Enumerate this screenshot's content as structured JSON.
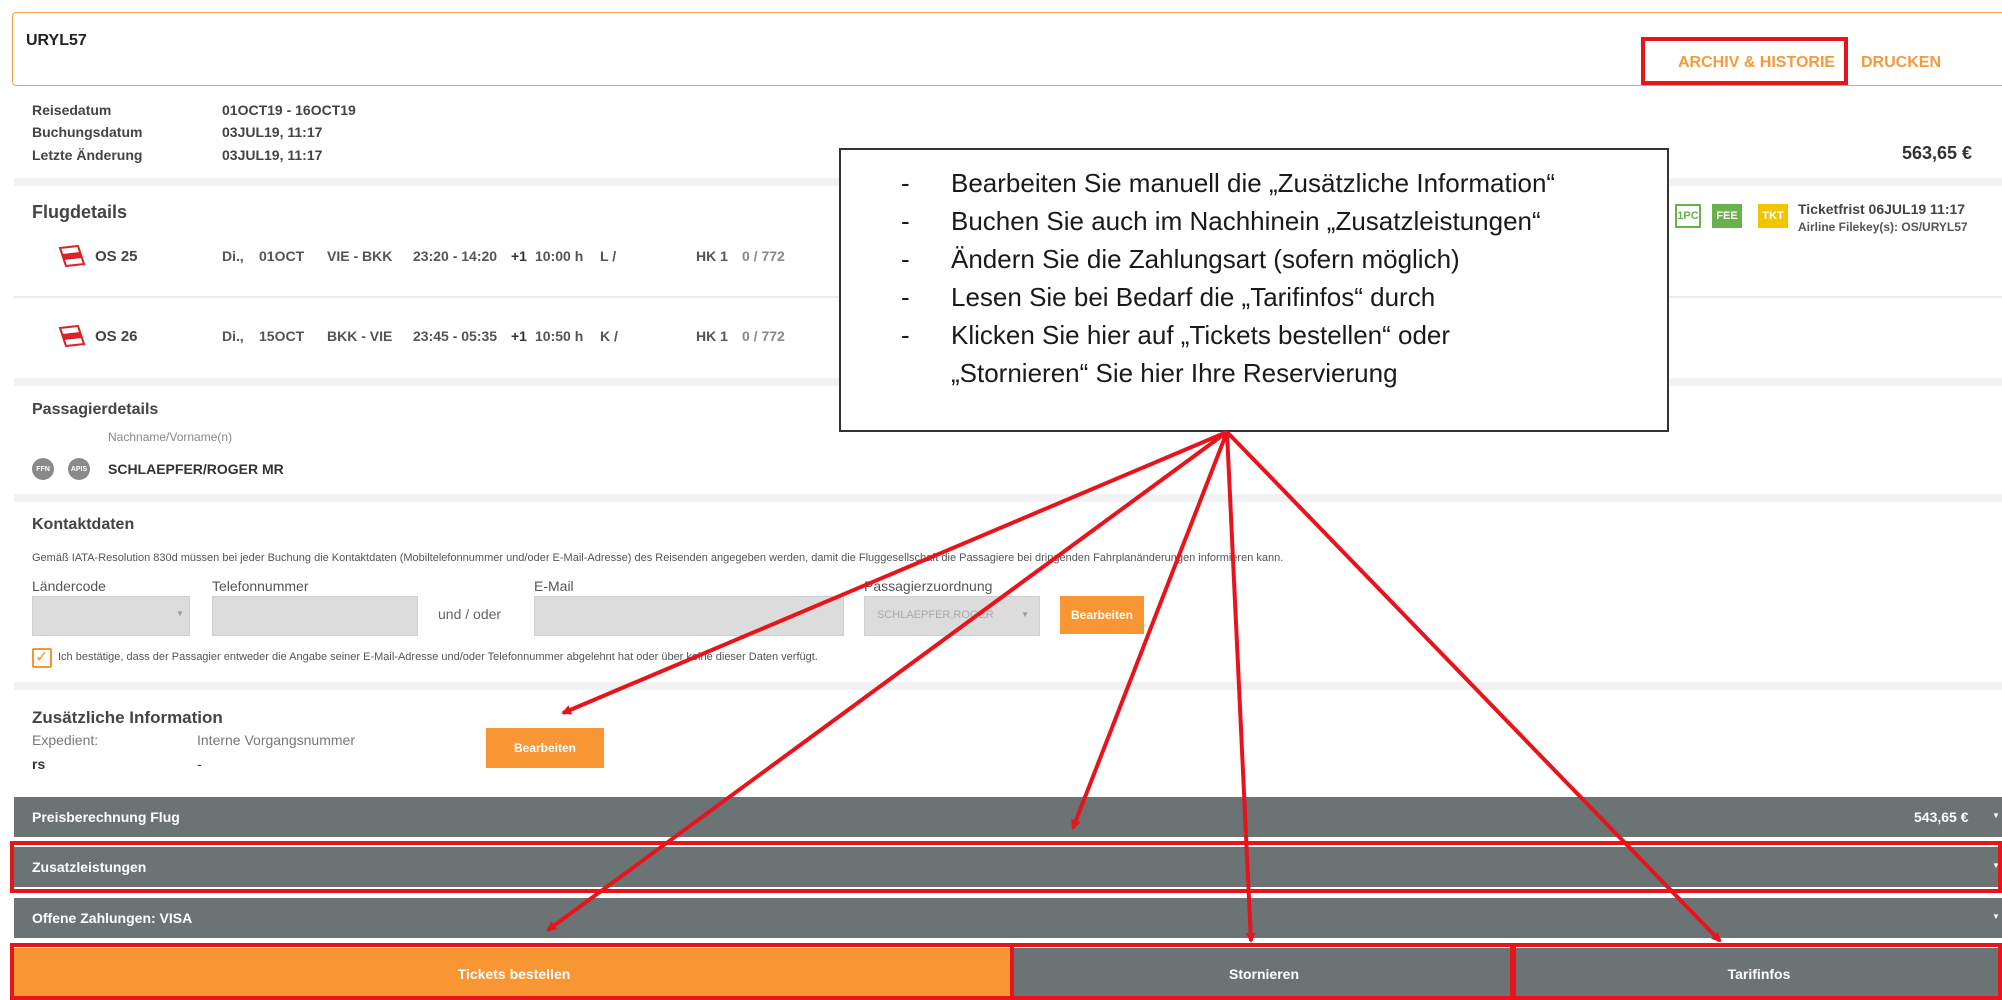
{
  "header": {
    "booking_code": "URYL57",
    "archive_link": "ARCHIV & HISTORIE",
    "print_link": "DRUCKEN"
  },
  "booking_info": {
    "travel_date_label": "Reisedatum",
    "travel_date_value": "01OCT19 - 16OCT19",
    "booking_date_label": "Buchungsdatum",
    "booking_date_value": "03JUL19, 11:17",
    "last_change_label": "Letzte Änderung",
    "last_change_value": "03JUL19, 11:17",
    "total_price": "563,65 €"
  },
  "flights": {
    "title": "Flugdetails",
    "badges": [
      "1PC",
      "FEE",
      "TKT"
    ],
    "ticket_deadline": "Ticketfrist 06JUL19 11:17",
    "airline_filekey": "Airline Filekey(s): OS/URYL57",
    "items": [
      {
        "code": "OS 25",
        "day": "Di.,",
        "date": "01OCT",
        "route": "VIE - BKK",
        "times": "23:20 - 14:20",
        "plus": "+1",
        "duration": "10:00 h",
        "class": "L /",
        "status": "HK 1",
        "extra": "0 / 772"
      },
      {
        "code": "OS 26",
        "day": "Di.,",
        "date": "15OCT",
        "route": "BKK - VIE",
        "times": "23:45 - 05:35",
        "plus": "+1",
        "duration": "10:50 h",
        "class": "K /",
        "status": "HK 1",
        "extra": "0 / 772"
      }
    ]
  },
  "passengers": {
    "title": "Passagierdetails",
    "name_header": "Nachname/Vorname(n)",
    "badge_ffn": "FFN",
    "badge_apis": "APIS",
    "name": "SCHLAEPFER/ROGER MR"
  },
  "contact": {
    "title": "Kontaktdaten",
    "notice": "Gemäß IATA-Resolution 830d müssen bei jeder Buchung die Kontaktdaten (Mobiltelefonnummer und/oder E-Mail-Adresse) des Reisenden angegeben werden, damit die Fluggesellschaft die Passagiere bei dringenden Fahrplanänderungen informieren kann.",
    "country_code_label": "Ländercode",
    "phone_label": "Telefonnummer",
    "or_label": "und / oder",
    "email_label": "E-Mail",
    "passenger_assign_label": "Passagierzuordnung",
    "passenger_assign_value": "SCHLAEPFER,ROGER",
    "edit_button": "Bearbeiten",
    "confirm_text": "Ich bestätige, dass der Passagier entweder die Angabe seiner E-Mail-Adresse und/oder Telefonnummer abgelehnt hat oder über keine dieser Daten verfügt."
  },
  "additional": {
    "title": "Zusätzliche Information",
    "expedient_label": "Expedient:",
    "expedient_value": "rs",
    "internal_label": "Interne Vorgangsnummer",
    "internal_value": "-",
    "edit_button": "Bearbeiten"
  },
  "bars": {
    "price_calc": "Preisberechnung Flug",
    "price_calc_value": "543,65 €",
    "extras": "Zusatzleistungen",
    "open_payments": "Offene Zahlungen: VISA"
  },
  "actions": {
    "order_tickets": "Tickets bestellen",
    "cancel": "Stornieren",
    "tariff_info": "Tarifinfos"
  },
  "callout": {
    "items": [
      "Bearbeiten Sie manuell die „Zusätzliche Information“",
      "Buchen Sie auch im Nachhinein „Zusatzleistungen“",
      "Ändern Sie die Zahlungsart (sofern möglich)",
      "Lesen Sie bei Bedarf die „Tarifinfos“ durch",
      "Klicken Sie hier auf „Tickets bestellen“ oder „Stornieren“ Sie hier Ihre Reservierung"
    ]
  },
  "colors": {
    "accent_orange": "#f79633",
    "bar_grey": "#6b7375",
    "annotation_red": "#e8141c"
  }
}
